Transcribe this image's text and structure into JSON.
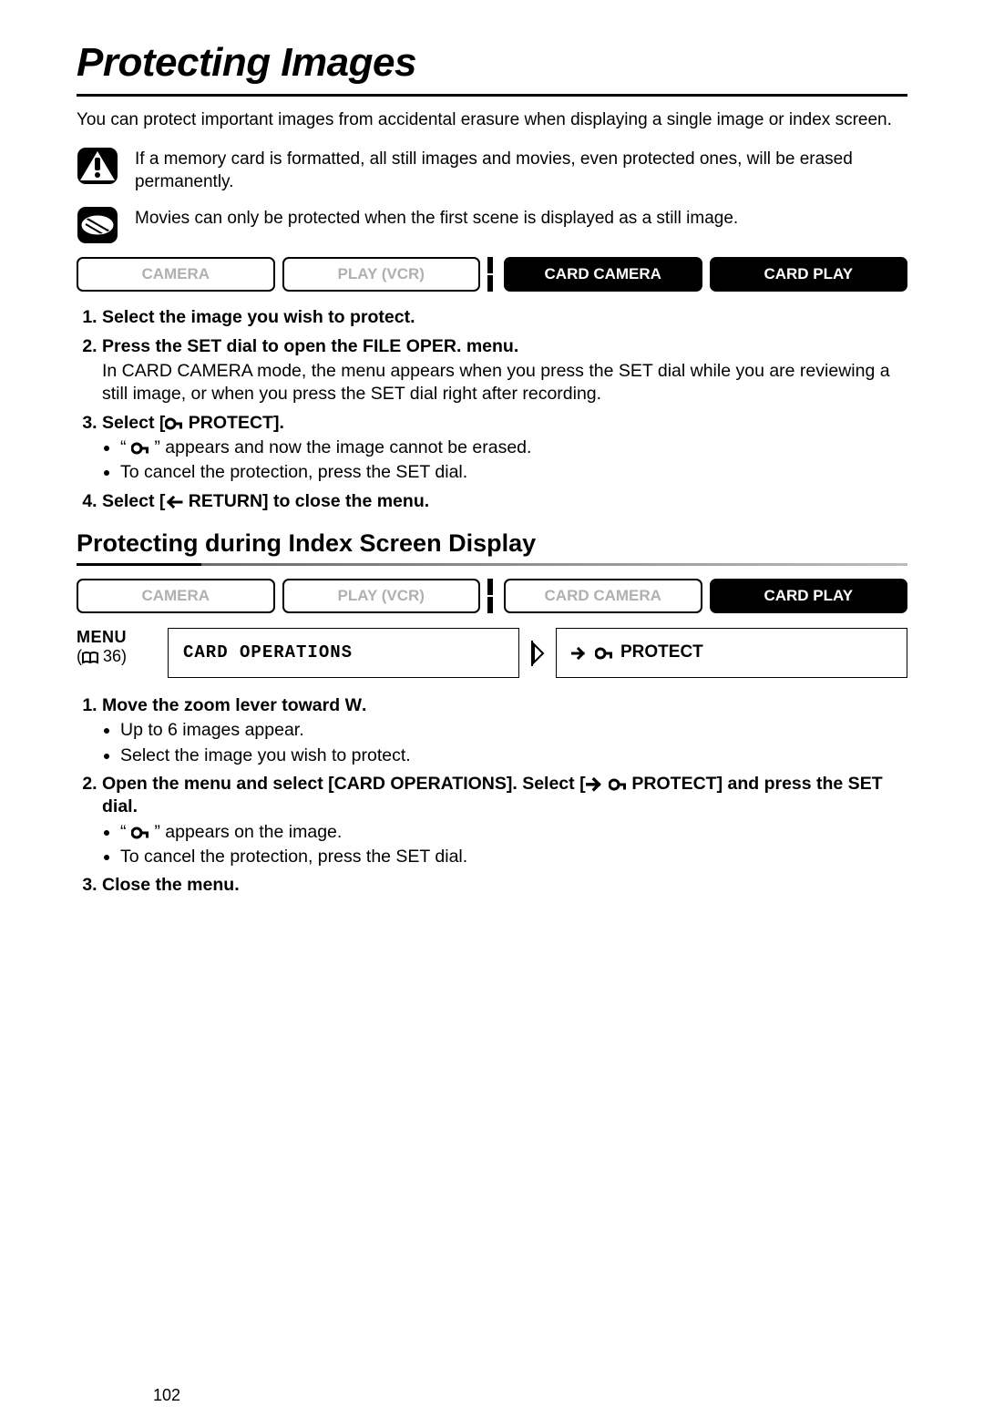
{
  "title": "Protecting Images",
  "intro": "You can protect important images from accidental erasure when displaying a single image or index screen.",
  "warning": "If a memory card is formatted, all still images and movies, even protected ones, will be erased permanently.",
  "info": "Movies can only be protected when the first scene is displayed as a still image.",
  "modes1": {
    "camera": "CAMERA",
    "play": "PLAY (VCR)",
    "card_camera": "CARD CAMERA",
    "card_play": "CARD PLAY"
  },
  "steps_a": {
    "s1": "Select the image you wish to protect.",
    "s2": "Press the SET dial to open the FILE OPER. menu.",
    "s2_sub": "In CARD CAMERA mode, the menu appears when you press the SET dial while you are reviewing a still image, or when you press the SET dial right after recording.",
    "s3_pre": "Select [",
    "s3_post": " PROTECT].",
    "s3_b1a": "“ ",
    "s3_b1b": " ” appears and now the image cannot be erased.",
    "s3_b2": "To cancel the protection, press the SET dial.",
    "s4_pre": "Select [",
    "s4_post": " RETURN] to close the menu."
  },
  "subheading": "Protecting during Index Screen Display",
  "modes2": {
    "camera": "CAMERA",
    "play": "PLAY (VCR)",
    "card_camera": "CARD CAMERA",
    "card_play": "CARD PLAY"
  },
  "menu": {
    "label_top": "MENU",
    "label_ref": " 36)",
    "box1": "CARD OPERATIONS",
    "box2": "PROTECT"
  },
  "steps_b": {
    "s1_pre": "Move the zoom lever toward ",
    "s1_post": ".",
    "s1_w": "W",
    "s1_b1": "Up to 6 images appear.",
    "s1_b2": "Select the image you wish to protect.",
    "s2_pre": "Open the menu and select [CARD OPERATIONS]. Select [",
    "s2_post": " PROTECT] and press the SET dial.",
    "s2_b1a": "“ ",
    "s2_b1b": " ” appears on the image.",
    "s2_b2": "To cancel the protection, press the SET dial.",
    "s3": "Close the menu."
  },
  "page_number": "102"
}
